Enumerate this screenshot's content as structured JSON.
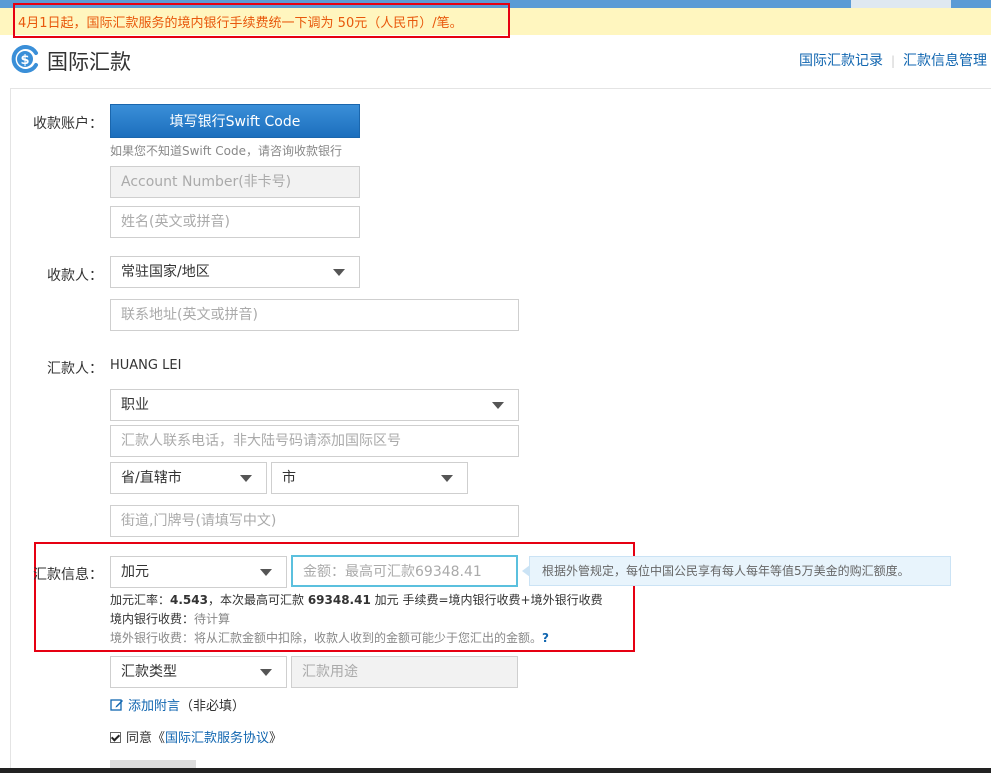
{
  "banner": {
    "text": "4月1日起，国际汇款服务的境内银行手续费统一下调为 50元（人民币）/笔。"
  },
  "header": {
    "title": "国际汇款",
    "links": [
      "国际汇款记录",
      "汇款信息管理"
    ]
  },
  "payee_account": {
    "label": "收款账户：",
    "swift_button": "填写银行Swift Code",
    "swift_hint": "如果您不知道Swift Code，请咨询收款银行",
    "account_placeholder": "Account Number(非卡号)",
    "name_placeholder": "姓名(英文或拼音)"
  },
  "payee": {
    "label": "收款人：",
    "country_select": "常驻国家/地区",
    "address_placeholder": "联系地址(英文或拼音)"
  },
  "remitter": {
    "label": "汇款人：",
    "name": "HUANG LEI",
    "occupation_select": "职业",
    "phone_placeholder": "汇款人联系电话，非大陆号码请添加国际区号",
    "province_select": "省/直辖市",
    "city_select": "市",
    "street_placeholder": "街道,门牌号(请填写中文)"
  },
  "remit_info": {
    "label": "汇款信息：",
    "currency_select": "加元",
    "amount_placeholder": "金额：最高可汇款69348.41",
    "tip": "根据外管规定，每位中国公民享有每人每年等值5万美金的购汇额度。",
    "rate_prefix": "加元汇率：",
    "rate_value": "4.543",
    "rate_mid": "，本次最高可汇款 ",
    "max_value": "69348.41",
    "rate_suffix": " 加元 手续费=境内银行收费+境外银行收费",
    "domestic_fee_label": "境内银行收费：",
    "domestic_fee_value": "待计算",
    "foreign_fee_text": "境外银行收费：将从汇款金额中扣除，收款人收到的金额可能少于您汇出的金额。",
    "help_mark": "?",
    "type_select": "汇款类型",
    "purpose_placeholder": "汇款用途"
  },
  "add_note": {
    "link": "添加附言",
    "suffix": "（非必填）"
  },
  "agreement": {
    "prefix": "同意",
    "open": "《",
    "link": "国际汇款服务协议",
    "close": "》"
  },
  "colors": {
    "accent": "#1166b0",
    "button": "#1c6fbd",
    "warning": "#e8580c",
    "highlight_box": "#e60012"
  },
  "icons": [
    "dollar-icon",
    "chevron-down-icon",
    "edit-icon",
    "checkbox-icon"
  ]
}
